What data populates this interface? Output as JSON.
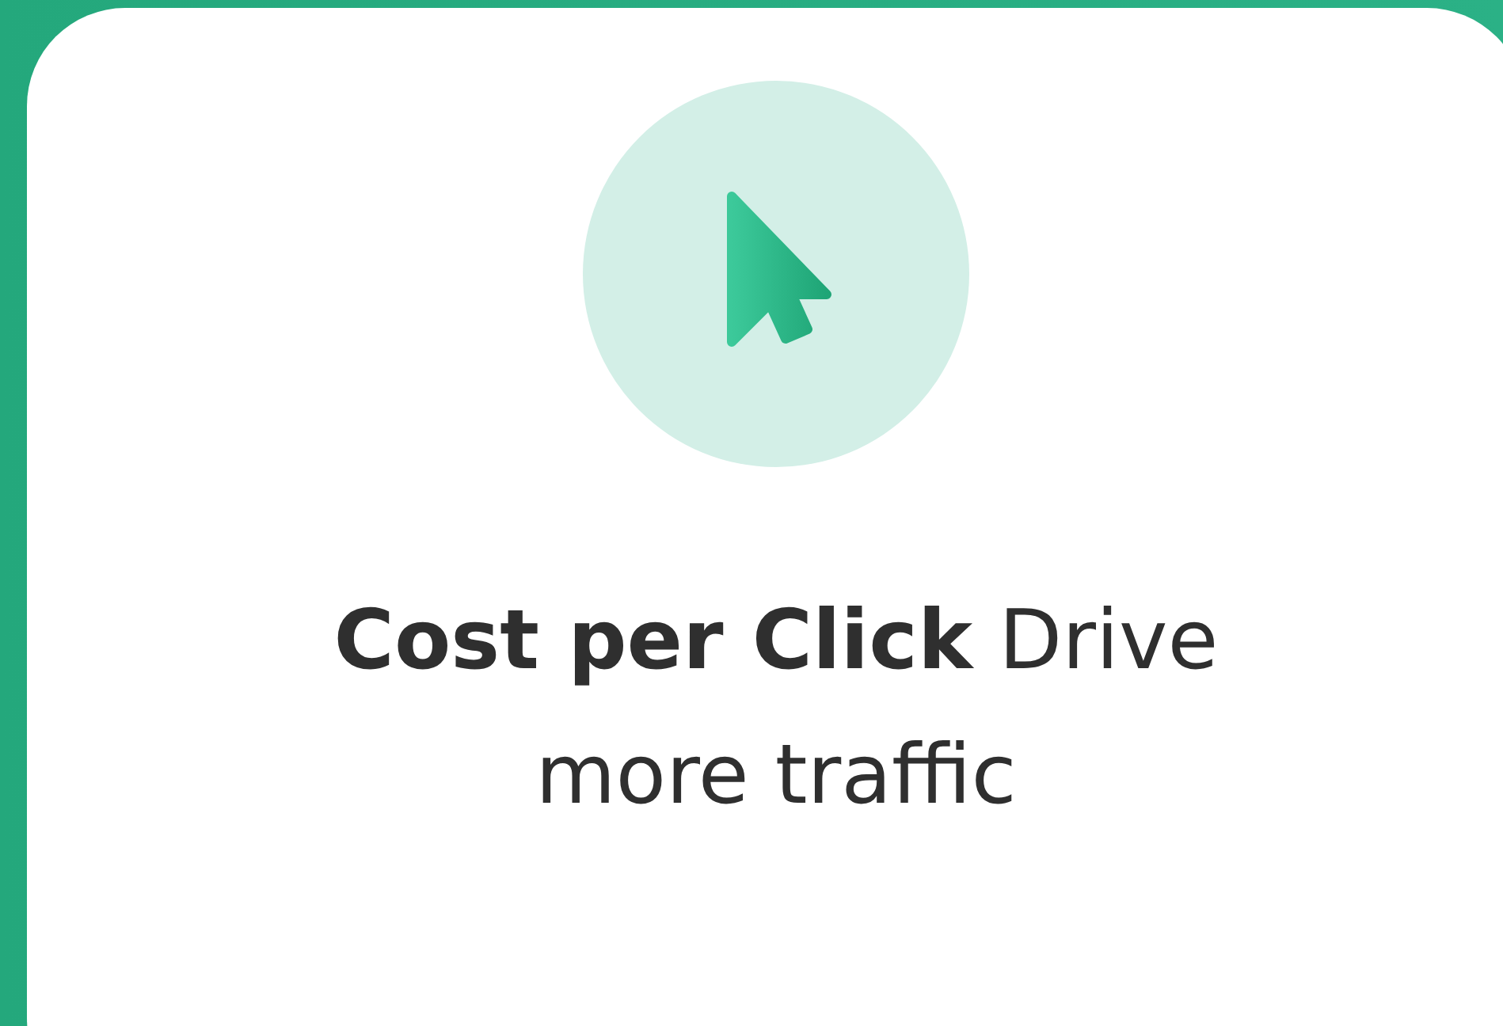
{
  "card": {
    "text": "**Cost per Click** Drive more traffic"
  }
}
